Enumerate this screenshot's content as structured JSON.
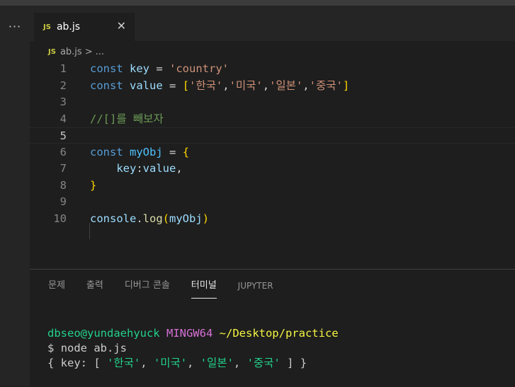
{
  "editor": {
    "tab": {
      "badge": "JS",
      "label": "ab.js",
      "close": "✕"
    },
    "breadcrumb": {
      "badge": "JS",
      "file": "ab.js",
      "separator": ">",
      "more": "..."
    },
    "lines": [
      {
        "n": "1",
        "tokens": [
          [
            "kw",
            "const"
          ],
          [
            "op",
            " "
          ],
          [
            "var",
            "key"
          ],
          [
            "op",
            " = "
          ],
          [
            "str",
            "'country'"
          ]
        ]
      },
      {
        "n": "2",
        "tokens": [
          [
            "kw",
            "const"
          ],
          [
            "op",
            " "
          ],
          [
            "var",
            "value"
          ],
          [
            "op",
            " = "
          ],
          [
            "br1",
            "["
          ],
          [
            "str",
            "'한국'"
          ],
          [
            "op",
            ","
          ],
          [
            "str",
            "'미국'"
          ],
          [
            "op",
            ","
          ],
          [
            "str",
            "'일본'"
          ],
          [
            "op",
            ","
          ],
          [
            "str",
            "'중국'"
          ],
          [
            "br1",
            "]"
          ]
        ]
      },
      {
        "n": "3",
        "tokens": []
      },
      {
        "n": "4",
        "tokens": [
          [
            "cmt",
            "//[]를 빼보자"
          ]
        ]
      },
      {
        "n": "5",
        "tokens": []
      },
      {
        "n": "6",
        "tokens": [
          [
            "kw",
            "const"
          ],
          [
            "op",
            " "
          ],
          [
            "cst",
            "myObj"
          ],
          [
            "op",
            " = "
          ],
          [
            "br1",
            "{"
          ]
        ]
      },
      {
        "n": "7",
        "tokens": [
          [
            "op",
            "    "
          ],
          [
            "var",
            "key"
          ],
          [
            "op",
            ":"
          ],
          [
            "var",
            "value"
          ],
          [
            "op",
            ","
          ]
        ]
      },
      {
        "n": "8",
        "tokens": [
          [
            "br1",
            "}"
          ]
        ]
      },
      {
        "n": "9",
        "tokens": []
      },
      {
        "n": "10",
        "tokens": [
          [
            "var",
            "console"
          ],
          [
            "op",
            "."
          ],
          [
            "fn",
            "log"
          ],
          [
            "br1",
            "("
          ],
          [
            "var",
            "myObj"
          ],
          [
            "br1",
            ")"
          ]
        ]
      }
    ]
  },
  "panel": {
    "tabs": [
      "문제",
      "출력",
      "디버그 콘솔",
      "터미널",
      "JUPYTER"
    ],
    "active_tab": "터미널"
  },
  "terminal": {
    "user": "dbseo@yundaehyuck",
    "env": "MINGW64",
    "path": "~/Desktop/practice",
    "prompt": "$",
    "command": "node ab.js",
    "output": {
      "open": "{ key: [ ",
      "items": [
        "'한국'",
        "'미국'",
        "'일본'",
        "'중국'"
      ],
      "close": " ] }"
    }
  },
  "activity": {
    "more_label": "···"
  },
  "colors": {
    "background": "#1e1e1e",
    "accent": "#cbcb41"
  }
}
